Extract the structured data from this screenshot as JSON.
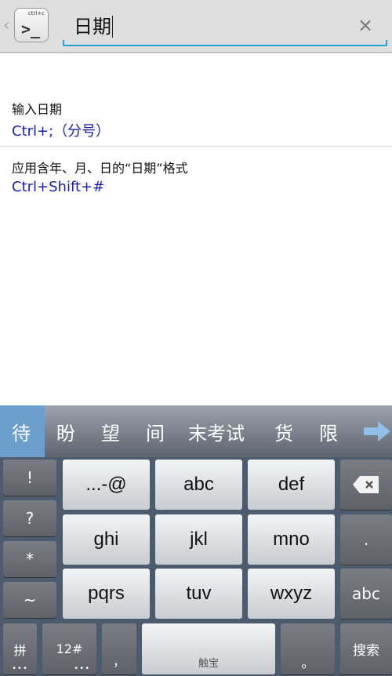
{
  "header": {
    "app_icon_label": "ctrl+c",
    "app_icon_prompt": ">_",
    "query": "日期",
    "clear": "×",
    "back": "‹"
  },
  "results": [
    {
      "label": "输入日期",
      "shortcut": "Ctrl+;（分号）"
    },
    {
      "label": "应用含年、月、日的“日期”格式",
      "shortcut": "Ctrl+Shift+#"
    }
  ],
  "keyboard": {
    "candidates": [
      "待",
      "盼",
      "望",
      "间",
      "末考试",
      "货",
      "限"
    ],
    "candidate_colors": {
      "selected": "#6d9fcc"
    },
    "left_column": [
      "!",
      "?",
      "*",
      "~"
    ],
    "t9": [
      "...-@",
      "abc",
      "def",
      "ghi",
      "jkl",
      "mno",
      "pqrs",
      "tuv",
      "wxyz"
    ],
    "right_column": [
      "⌫",
      ".",
      "abc"
    ],
    "bottom": {
      "pinyin": "拼",
      "num": "12#",
      "comma": "，",
      "space": "触宝",
      "period": "。",
      "search": "搜索",
      "more": "•••"
    }
  }
}
